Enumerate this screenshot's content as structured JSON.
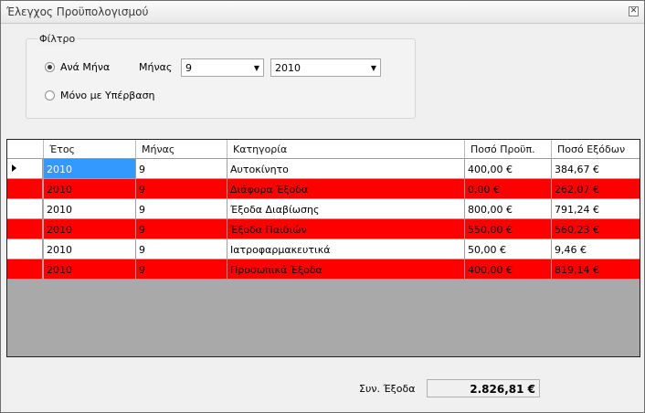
{
  "window": {
    "title": "Έλεγχος Προϋπολογισμού"
  },
  "filter": {
    "legend": "Φίλτρο",
    "by_month_label": "Ανά Μήνα",
    "overrun_only_label": "Μόνο με Υπέρβαση",
    "by_month_selected": true,
    "month_label": "Μήνας",
    "month_value": "9",
    "year_value": "2010"
  },
  "grid": {
    "columns": [
      "Έτος",
      "Μήνας",
      "Κατηγορία",
      "Ποσό Προϋπ.",
      "Ποσό Εξόδων"
    ],
    "rows": [
      {
        "year": "2010",
        "month": "9",
        "category": "Αυτοκίνητο",
        "budget": "400,00 €",
        "expenses": "384,67 €",
        "over": false
      },
      {
        "year": "2010",
        "month": "9",
        "category": "Διάφορα Έξοδα",
        "budget": "0,00 €",
        "expenses": "262,07 €",
        "over": true
      },
      {
        "year": "2010",
        "month": "9",
        "category": "Έξοδα Διαβίωσης",
        "budget": "800,00 €",
        "expenses": "791,24 €",
        "over": false
      },
      {
        "year": "2010",
        "month": "9",
        "category": "Έξοδα Παιδιών",
        "budget": "550,00 €",
        "expenses": "560,23 €",
        "over": true
      },
      {
        "year": "2010",
        "month": "9",
        "category": "Ιατροφαρμακευτικά",
        "budget": "50,00 €",
        "expenses": "9,46 €",
        "over": false
      },
      {
        "year": "2010",
        "month": "9",
        "category": "Προσωπικά Έξοδα",
        "budget": "400,00 €",
        "expenses": "819,14 €",
        "over": true
      }
    ]
  },
  "footer": {
    "total_label": "Συν. Έξοδα",
    "total_value": "2.826,81 €"
  },
  "colors": {
    "overrun_row": "#ff0000",
    "selection": "#3399ff"
  }
}
